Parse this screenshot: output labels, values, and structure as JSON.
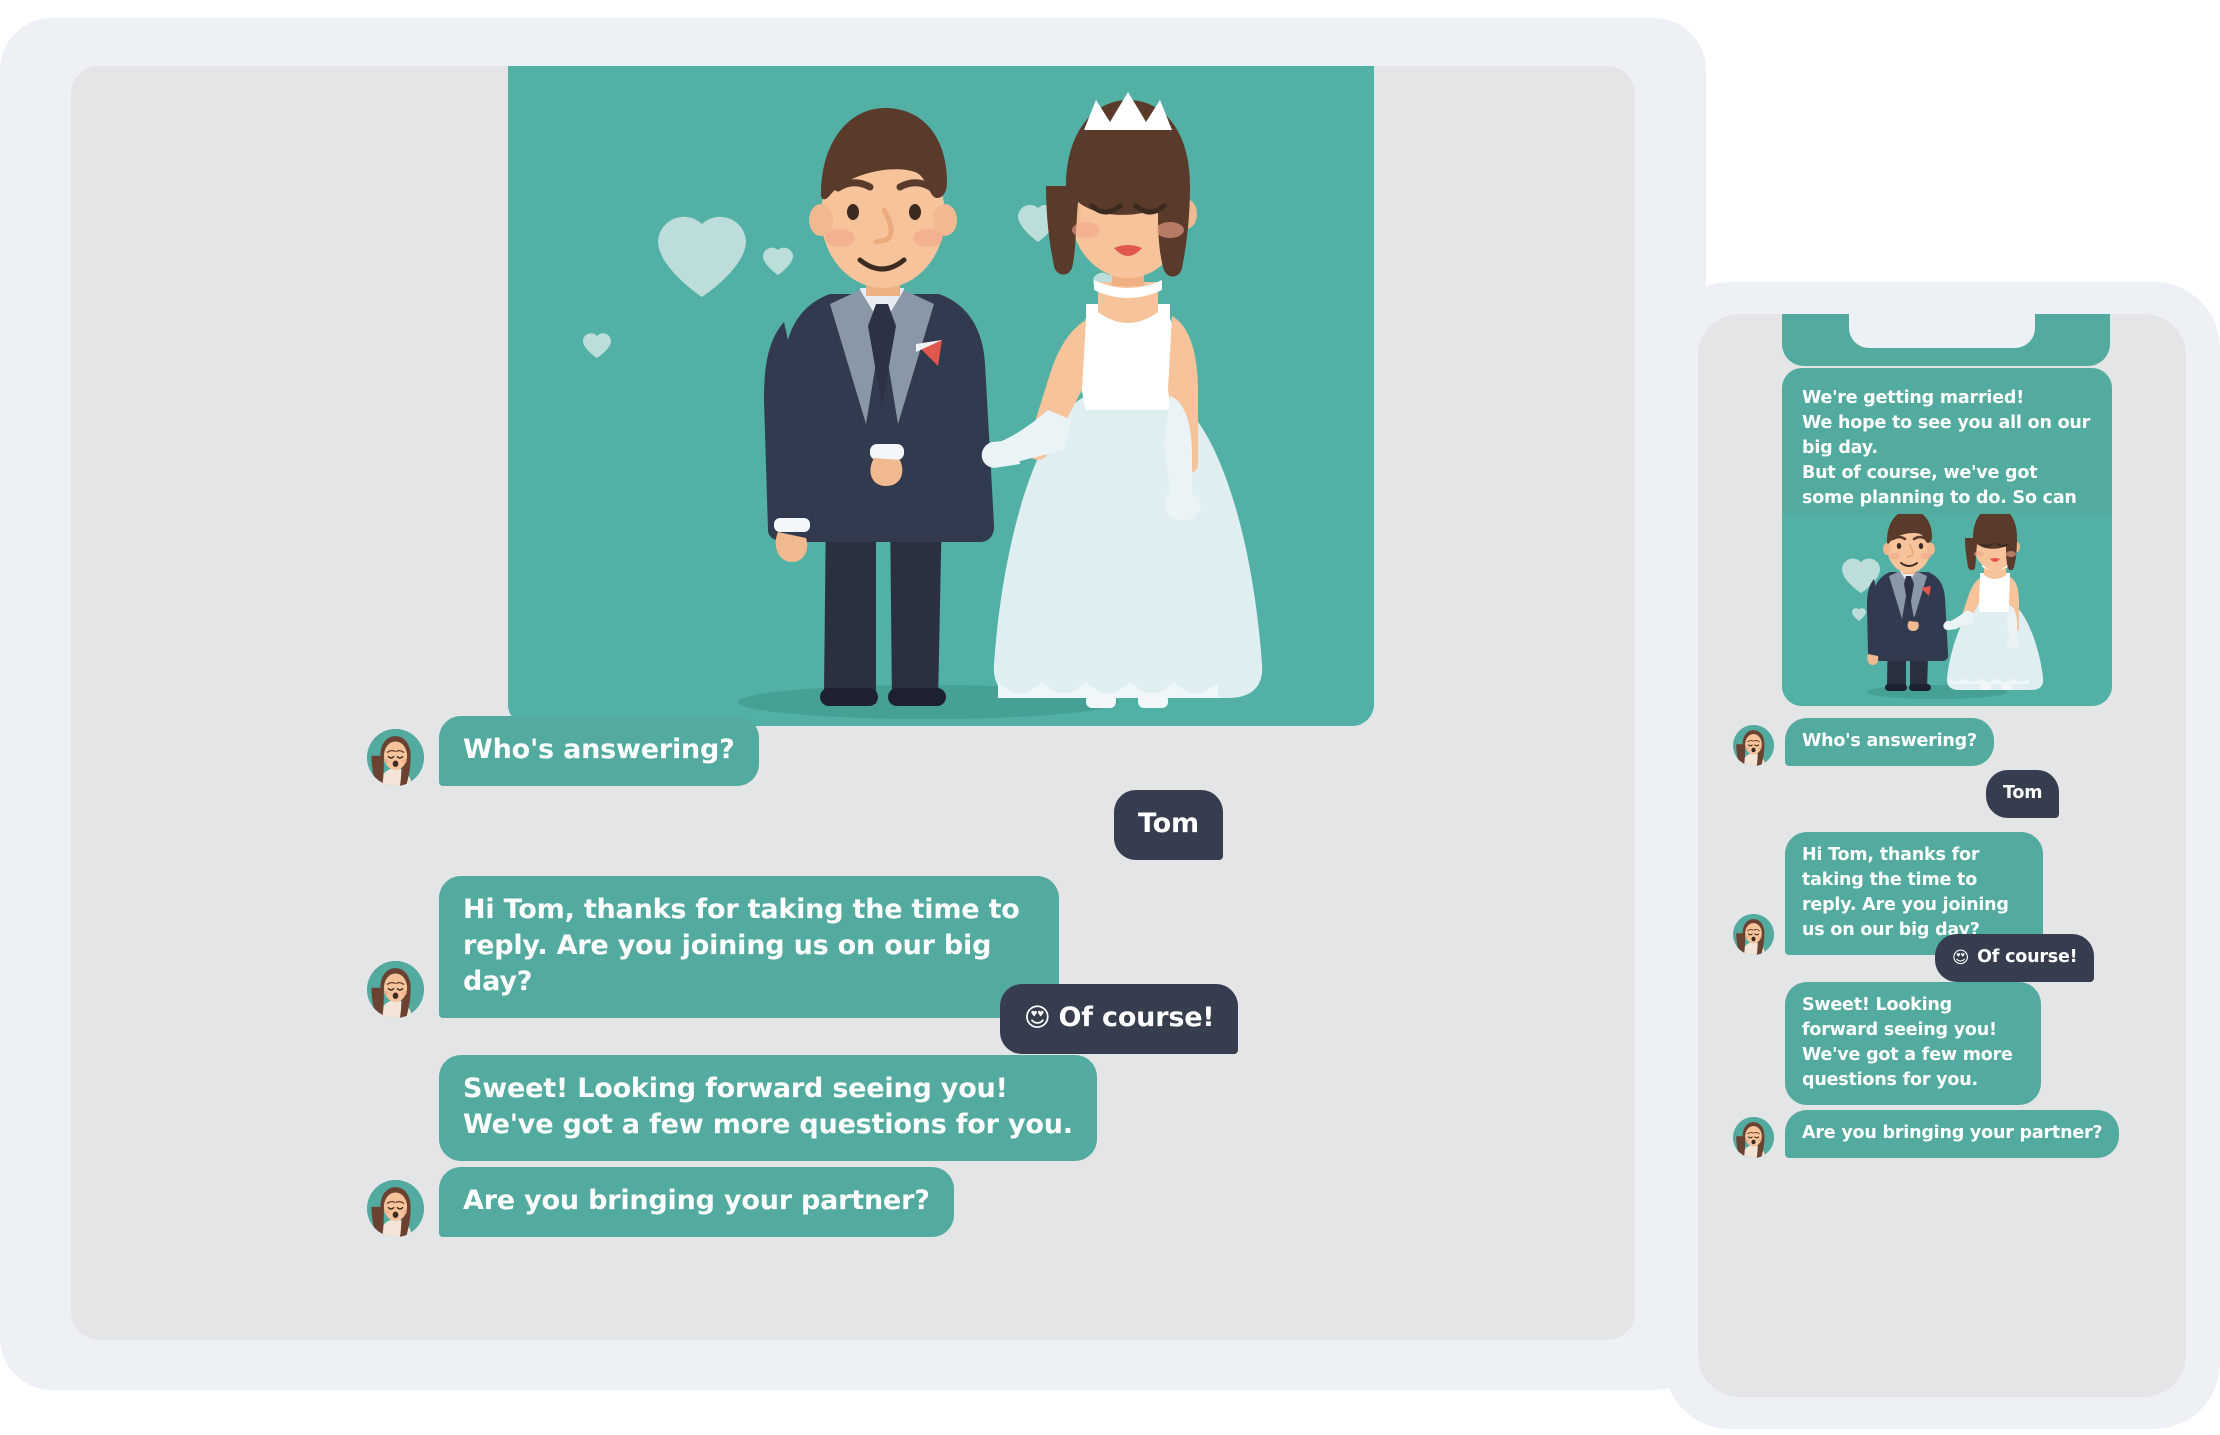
{
  "theme": {
    "teal_bubble": "#52ab9e",
    "teal_image_bg": "#52b0a4",
    "dark_bubble": "#353d4e",
    "screen_bg": "#e3e5e7",
    "device_bezel": "#edf0f5",
    "text_on_bubble": "#ffffff"
  },
  "devices": {
    "tablet": {
      "name": "tablet-device"
    },
    "phone": {
      "name": "phone-device"
    }
  },
  "conversation": {
    "hero_image_alt": "wedding-couple-illustration",
    "intro": {
      "line1": "We're getting married!",
      "line2": "We hope to see you all on our big day.",
      "line3": "But of course, we've got some planning to do. So can you please let us know if you're able to join?"
    },
    "messages": [
      {
        "id": "m1",
        "from": "bot",
        "text": "Who's answering?",
        "avatar": "woman-avatar"
      },
      {
        "id": "m2",
        "from": "user",
        "text": "Tom"
      },
      {
        "id": "m3",
        "from": "bot",
        "text": "Hi Tom, thanks for taking the time to reply. Are you joining us on our big day?",
        "avatar": "woman-avatar"
      },
      {
        "id": "m4",
        "from": "user",
        "emoji": "😍",
        "text": "Of course!"
      },
      {
        "id": "m5",
        "from": "bot",
        "line1": "Sweet! Looking forward seeing you!",
        "line2": "We've got a few more questions for you."
      },
      {
        "id": "m6",
        "from": "bot",
        "text": "Are you bringing your partner?",
        "avatar": "woman-avatar"
      }
    ]
  }
}
